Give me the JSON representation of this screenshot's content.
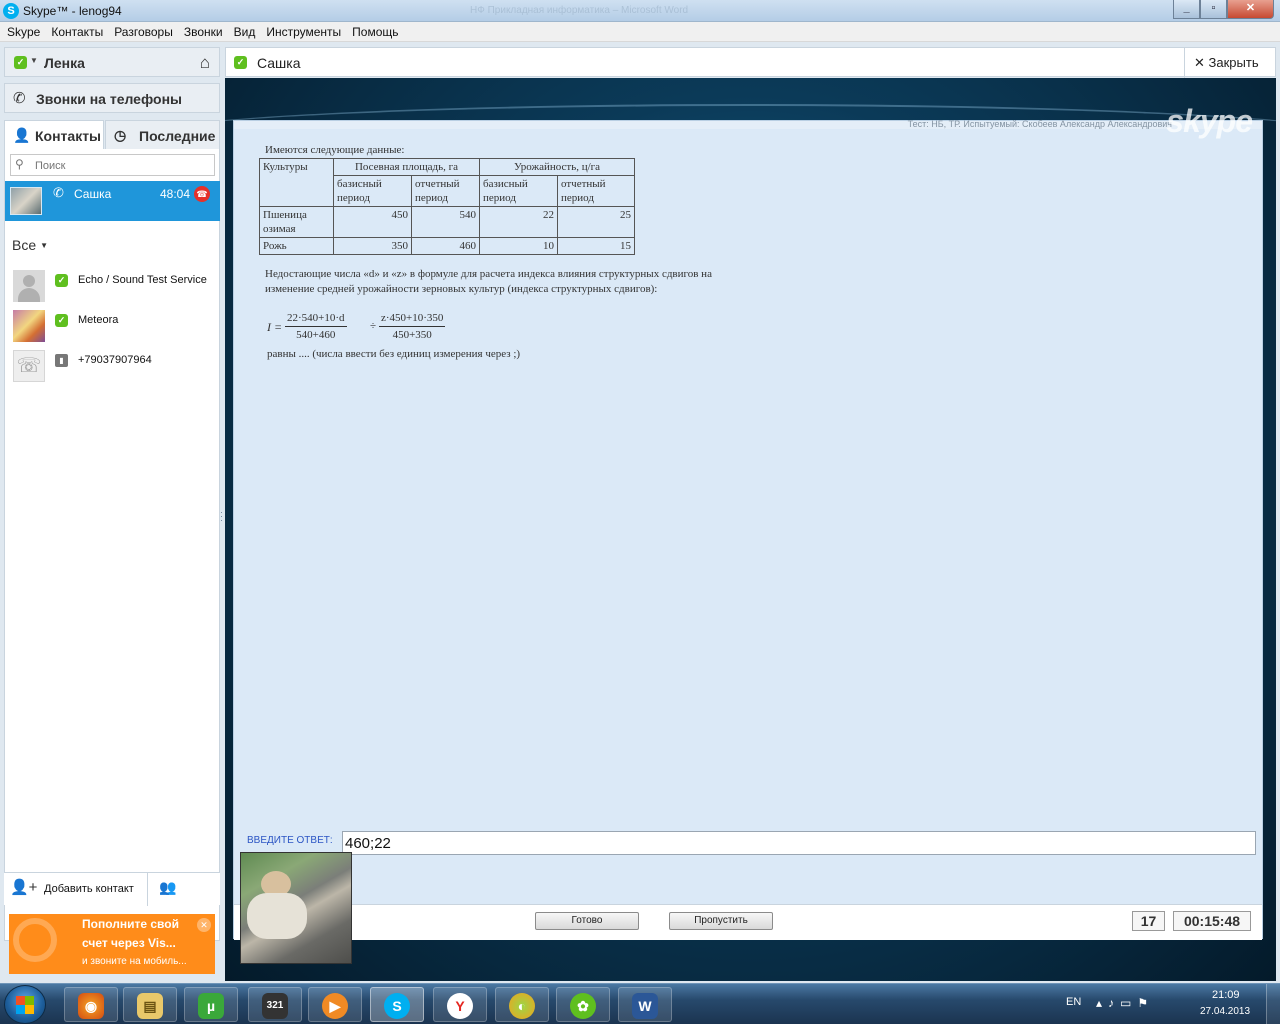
{
  "window": {
    "title": "Skype™ - lenog94",
    "background_ghost_text": "НФ Прикладная информатика – Microsoft Word"
  },
  "menu": [
    "Skype",
    "Контакты",
    "Разговоры",
    "Звонки",
    "Вид",
    "Инструменты",
    "Помощь"
  ],
  "sidebar": {
    "profile_name": "Ленка",
    "calls_label": "Звонки на телефоны",
    "tabs": {
      "contacts": "Контакты",
      "recent": "Последние"
    },
    "search_placeholder": "Поиск",
    "active_call": {
      "name": "Сашка",
      "duration": "48:04"
    },
    "group_filter": "Все",
    "contacts": [
      {
        "name": "Echo / Sound Test Service",
        "status": "online"
      },
      {
        "name": "Meteora",
        "status": "online"
      },
      {
        "name": "+79037907964",
        "status": "phone"
      }
    ],
    "add_contact_label": "Добавить контакт",
    "promo": {
      "line1": "Пополните свой",
      "line2": "счет через  Vis...",
      "line3": "и звоните на мобиль..."
    }
  },
  "conversation": {
    "contact_name": "Сашка",
    "close_label": "Закрыть",
    "watermark": "skype",
    "shared_screen": {
      "test_info": "Тест: НБ, ТР. Испытуемый: Скобеев Александр Александрович",
      "intro": "Имеются следующие данные:",
      "table": {
        "header_crop": "Культуры",
        "header_area": "Посевная площадь, га",
        "header_yield": "Урожайность, ц/га",
        "sub_base": "базисный период",
        "sub_report": "отчетный период",
        "rows": [
          {
            "crop": "Пшеница озимая",
            "area_base": "450",
            "area_report": "540",
            "yield_base": "22",
            "yield_report": "25"
          },
          {
            "crop": "Рожь",
            "area_base": "350",
            "area_report": "460",
            "yield_base": "10",
            "yield_report": "15"
          }
        ]
      },
      "question": "Недостающие числа «d» и «z» в формуле для расчета индекса влияния структурных сдвигов на изменение средней урожайности зерновых культур (индекса структурных сдвигов):",
      "formula": {
        "lhs": "I =",
        "num1": "22·540+10·d",
        "den1": "540+460",
        "op": "÷",
        "num2": "z·450+10·350",
        "den2": "450+350"
      },
      "tail": "равны .... (числа ввести без единиц измерения через ;)",
      "answer_label": "ВВЕДИТЕ ОТВЕТ:",
      "answer_value": "460;22",
      "ready_button": "Готово",
      "skip_button": "Пропустить",
      "question_number": "17",
      "timer": "00:15:48"
    }
  },
  "taskbar": {
    "apps": [
      "start",
      "firefox",
      "explorer",
      "utorrent",
      "media-player-classic",
      "player",
      "skype",
      "yandex",
      "browser",
      "icq",
      "word"
    ],
    "language": "EN",
    "time": "21:09",
    "date": "27.04.2013"
  }
}
